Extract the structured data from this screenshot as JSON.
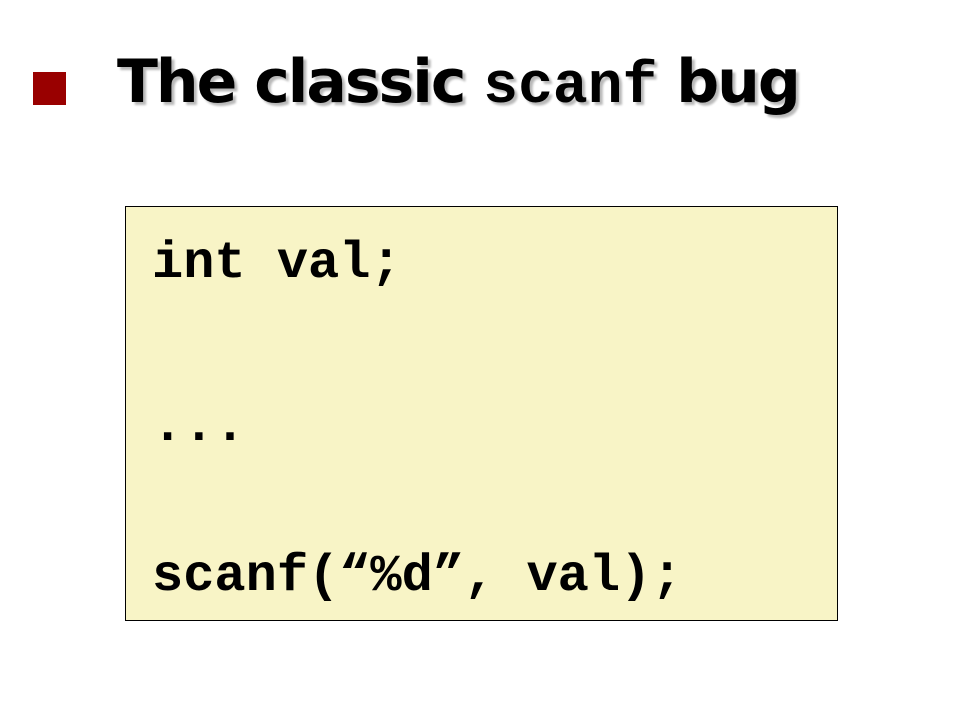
{
  "slide": {
    "title_prefix": "The classic ",
    "title_code": "scanf",
    "title_suffix": " bug",
    "bullet_color": "#990000"
  },
  "code_box": {
    "background": "#f8f4c6",
    "lines": [
      "int val;",
      "...",
      "scanf(“%d”, val);"
    ]
  }
}
